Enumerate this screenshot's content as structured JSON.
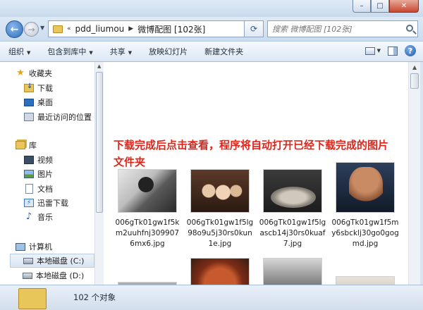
{
  "window": {
    "minimize": "–",
    "maximize": "□",
    "close": "✕"
  },
  "address": {
    "back": "←",
    "forward": "→",
    "crumb_sep": "«",
    "crumbs": [
      "pdd_liumou",
      "微博配图 [102张]"
    ],
    "refresh": "⟳",
    "search_placeholder": "搜索 微博配图 [102张]"
  },
  "toolbar": {
    "organize": "组织",
    "include_in_library": "包含到库中",
    "share": "共享",
    "slideshow": "放映幻灯片",
    "new_folder": "新建文件夹",
    "help": "?"
  },
  "sidebar": {
    "favorites": "收藏夹",
    "downloads": "下载",
    "desktop": "桌面",
    "recent": "最近访问的位置",
    "libraries": "库",
    "videos": "视频",
    "pictures": "图片",
    "documents": "文档",
    "thunder": "迅雷下载",
    "music": "音乐",
    "computer": "计算机",
    "disk_c": "本地磁盘 (C:)",
    "disk_d": "本地磁盘 (D:)"
  },
  "content": {
    "notice": "下载完成后点击查看，程序将自动打开已经下载完成的图片文件夹",
    "files": [
      "006gTk01gw1f5km2uuhfnj3099076mx6.jpg",
      "006gTk01gw1f5lg98o9u5j30rs0kun1e.jpg",
      "006gTk01gw1f5lgascb14j30rs0kuaf7.jpg",
      "006gTk01gw1f5my6sbcklj30go0gogmd.jpg"
    ]
  },
  "status": {
    "count": "102 个对象"
  }
}
